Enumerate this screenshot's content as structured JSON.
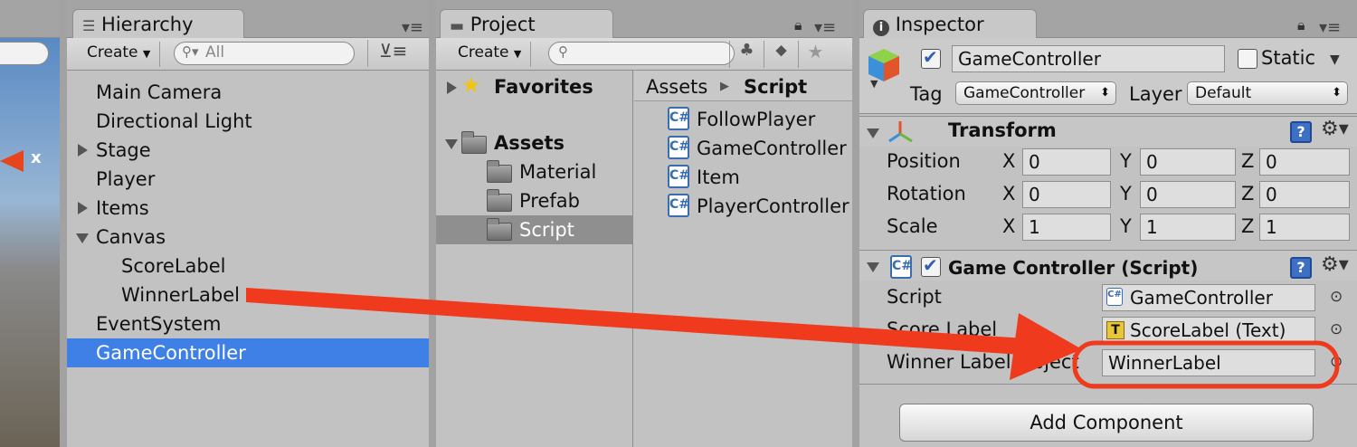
{
  "scene": {
    "axis_label": "x"
  },
  "hierarchy": {
    "tab": "Hierarchy",
    "create": "Create",
    "search_placeholder": "All",
    "items": [
      {
        "label": "Main Camera"
      },
      {
        "label": "Directional Light"
      },
      {
        "label": "Stage"
      },
      {
        "label": "Player"
      },
      {
        "label": "Items"
      },
      {
        "label": "Canvas"
      },
      {
        "label": "ScoreLabel"
      },
      {
        "label": "WinnerLabel"
      },
      {
        "label": "EventSystem"
      },
      {
        "label": "GameController"
      }
    ]
  },
  "project": {
    "tab": "Project",
    "create": "Create",
    "tree": {
      "favorites": "Favorites",
      "assets": "Assets",
      "folders": [
        "Material",
        "Prefab",
        "Script"
      ]
    },
    "breadcrumb": {
      "root": "Assets",
      "current": "Script"
    },
    "files": [
      "FollowPlayer",
      "GameController",
      "Item",
      "PlayerController"
    ]
  },
  "inspector": {
    "tab": "Inspector",
    "object_name": "GameController",
    "static_label": "Static",
    "tag_label": "Tag",
    "tag_value": "GameController",
    "layer_label": "Layer",
    "layer_value": "Default",
    "transform": {
      "title": "Transform",
      "rows": [
        {
          "label": "Position",
          "x": "0",
          "y": "0",
          "z": "0"
        },
        {
          "label": "Rotation",
          "x": "0",
          "y": "0",
          "z": "0"
        },
        {
          "label": "Scale",
          "x": "1",
          "y": "1",
          "z": "1"
        }
      ],
      "axes": {
        "x": "X",
        "y": "Y",
        "z": "Z"
      }
    },
    "component": {
      "title": "Game Controller (Script)",
      "script_label": "Script",
      "script_value": "GameController",
      "score_label": "Score Label",
      "score_value": "ScoreLabel (Text)",
      "winner_label": "Winner Label Object",
      "winner_value": "WinnerLabel"
    },
    "add_component": "Add Component"
  },
  "colors": {
    "selection": "#3f80e6",
    "annotation": "#f03a1e"
  }
}
